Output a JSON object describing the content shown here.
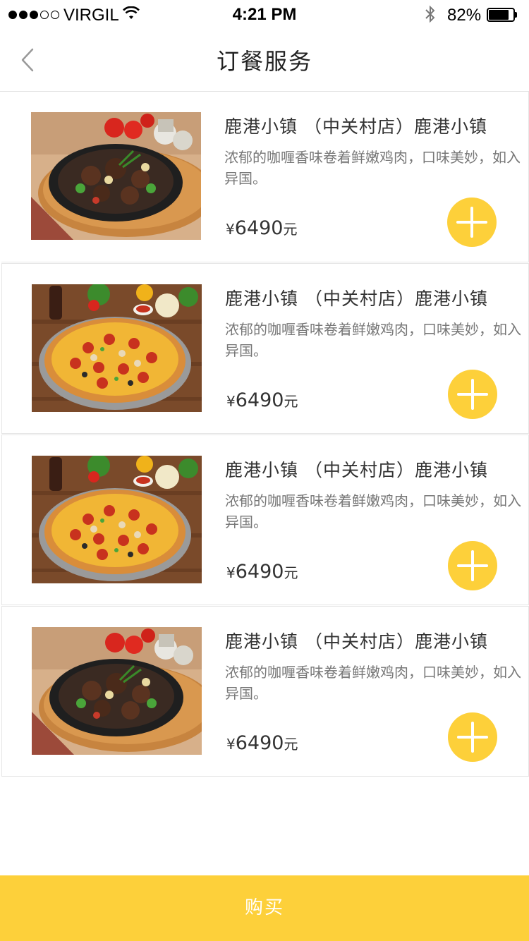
{
  "status_bar": {
    "carrier": "VIRGIL",
    "time": "4:21 PM",
    "battery_percent_text": "82%",
    "battery_level": 0.82,
    "signal_bars": 3,
    "signal_total": 5
  },
  "nav": {
    "title": "订餐服务",
    "back_icon": "chevron-left-icon"
  },
  "items": [
    {
      "title": "鹿港小镇 （中关村店）鹿港小镇",
      "description": "浓郁的咖喱香味卷着鲜嫩鸡肉，口味美妙，如入异国。",
      "price_symbol": "¥",
      "price": "6490",
      "price_unit": "元",
      "image": "sizzling-beef-plate"
    },
    {
      "title": "鹿港小镇 （中关村店）鹿港小镇",
      "description": "浓郁的咖喱香味卷着鲜嫩鸡肉，口味美妙，如入异国。",
      "price_symbol": "¥",
      "price": "6490",
      "price_unit": "元",
      "image": "pepperoni-pizza"
    },
    {
      "title": "鹿港小镇 （中关村店）鹿港小镇",
      "description": "浓郁的咖喱香味卷着鲜嫩鸡肉，口味美妙，如入异国。",
      "price_symbol": "¥",
      "price": "6490",
      "price_unit": "元",
      "image": "pepperoni-pizza"
    },
    {
      "title": "鹿港小镇 （中关村店）鹿港小镇",
      "description": "浓郁的咖喱香味卷着鲜嫩鸡肉，口味美妙，如入异国。",
      "price_symbol": "¥",
      "price": "6490",
      "price_unit": "元",
      "image": "sizzling-beef-plate"
    }
  ],
  "buy_button": {
    "label": "购买"
  },
  "colors": {
    "accent": "#fdd03a",
    "divider": "#e6e6e6",
    "text_primary": "#333333",
    "text_secondary": "#777777"
  }
}
